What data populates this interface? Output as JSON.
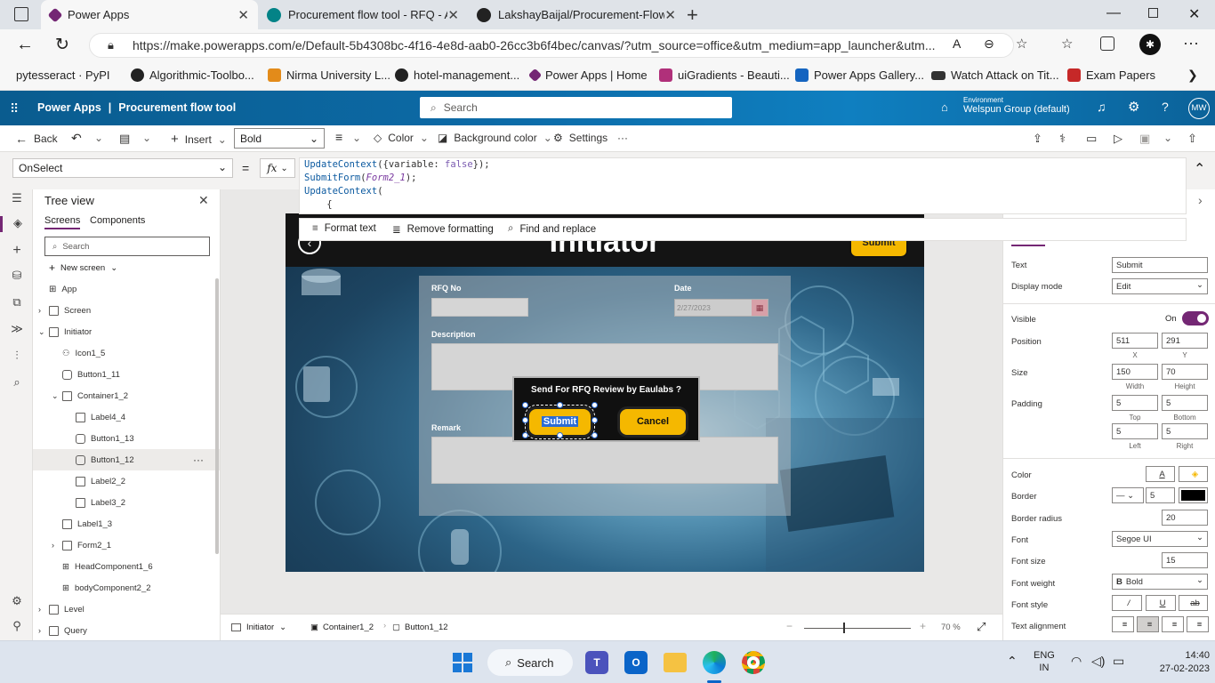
{
  "browser": {
    "tabs": [
      {
        "title": "Power Apps"
      },
      {
        "title": "Procurement flow tool - RFQ - Al"
      },
      {
        "title": "LakshayBaijal/Procurement-Flow-"
      }
    ],
    "url": "https://make.powerapps.com/e/Default-5b4308bc-4f16-4e8d-aab0-26cc3b6f4bec/canvas/?utm_source=office&utm_medium=app_launcher&utm...",
    "bookmarks": [
      "pytesseract · PyPI",
      "Algorithmic-Toolbo...",
      "Nirma University L...",
      "hotel-management...",
      "Power Apps | Home",
      "uiGradients - Beauti...",
      "Power Apps Gallery...",
      "Watch Attack on Tit...",
      "Exam Papers"
    ]
  },
  "header": {
    "app_name": "Power Apps",
    "separator": "|",
    "project": "Procurement flow tool",
    "search_placeholder": "Search",
    "env_label": "Environment",
    "env_name": "Welspun Group (default)",
    "avatar": "MW"
  },
  "command_bar": {
    "back": "Back",
    "insert": "Insert",
    "font_weight_value": "Bold",
    "color": "Color",
    "background_color": "Background color",
    "settings": "Settings",
    "more": "···"
  },
  "formula_bar": {
    "property": "OnSelect",
    "equals": "=",
    "fx": "fx",
    "code_lines": [
      "UpdateContext({variable: false});",
      "SubmitForm(Form2_1);",
      "UpdateContext(",
      "    {",
      "        "
    ],
    "format_text": "Format text",
    "remove_formatting": "Remove formatting",
    "find_replace": "Find and replace"
  },
  "tree": {
    "title": "Tree view",
    "tabs": [
      "Screens",
      "Components"
    ],
    "search_placeholder": "Search",
    "new_screen": "New screen",
    "nodes": [
      {
        "label": "App"
      },
      {
        "label": "Screen"
      },
      {
        "label": "Initiator"
      },
      {
        "label": "Icon1_5"
      },
      {
        "label": "Button1_11"
      },
      {
        "label": "Container1_2"
      },
      {
        "label": "Label4_4"
      },
      {
        "label": "Button1_13"
      },
      {
        "label": "Button1_12"
      },
      {
        "label": "Label2_2"
      },
      {
        "label": "Label3_2"
      },
      {
        "label": "Label1_3"
      },
      {
        "label": "Form2_1"
      },
      {
        "label": "HeadComponent1_6"
      },
      {
        "label": "bodyComponent2_2"
      },
      {
        "label": "Level"
      },
      {
        "label": "Query"
      }
    ]
  },
  "canvas": {
    "page_title": "Initiator",
    "top_submit": "Submit",
    "rfq_no_label": "RFQ No",
    "date_label": "Date",
    "date_value": "2/27/2023",
    "description_label": "Description",
    "remark_label": "Remark",
    "dialog_title": "Send For RFQ Review by Eaulabs ?",
    "dialog_submit": "Submit",
    "dialog_cancel": "Cancel"
  },
  "bottom_bar": {
    "crumbs": [
      "Initiator",
      "Container1_2",
      "Button1_12"
    ],
    "zoom": "70  %"
  },
  "properties": {
    "text_label": "Text",
    "text_value": "Submit",
    "display_mode_label": "Display mode",
    "display_mode_value": "Edit",
    "visible_label": "Visible",
    "visible_value": "On",
    "position_label": "Position",
    "pos_x": "511",
    "pos_y": "291",
    "x": "X",
    "y": "Y",
    "size_label": "Size",
    "width": "150",
    "height": "70",
    "width_sub": "Width",
    "height_sub": "Height",
    "padding_label": "Padding",
    "pad_top": "5",
    "pad_bottom": "5",
    "pad_left": "5",
    "pad_right": "5",
    "top_sub": "Top",
    "bottom_sub": "Bottom",
    "left_sub": "Left",
    "right_sub": "Right",
    "color_label": "Color",
    "border_label": "Border",
    "border_width": "5",
    "border_radius_label": "Border radius",
    "border_radius": "20",
    "font_label": "Font",
    "font_value": "Segoe UI",
    "font_size_label": "Font size",
    "font_size": "15",
    "font_weight_label": "Font weight",
    "font_weight": "Bold",
    "font_style_label": "Font style",
    "text_align_label": "Text alignment"
  },
  "taskbar": {
    "search": "Search",
    "lang1": "ENG",
    "lang2": "IN",
    "time": "14:40",
    "date": "27-02-2023"
  },
  "colors": {
    "accent_purple": "#742774",
    "button_yellow": "#f5b800",
    "header_blue": "#0c6aa6"
  }
}
